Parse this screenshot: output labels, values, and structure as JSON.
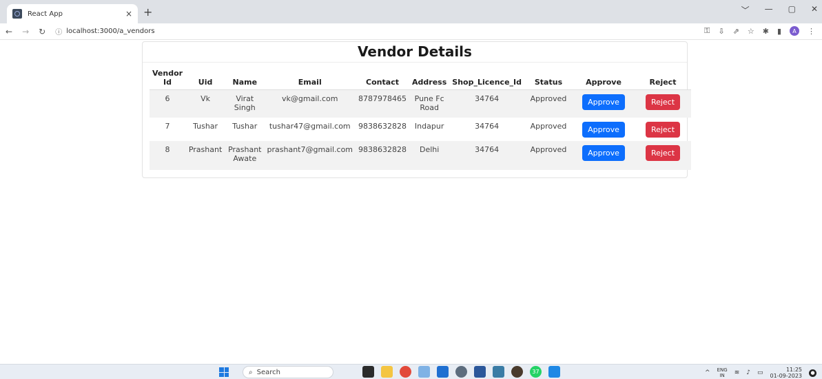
{
  "browser": {
    "tab_title": "React App",
    "tab_close": "×",
    "new_tab": "+",
    "url": "localhost:3000/a_vendors",
    "window_controls": [
      "﹀",
      "—",
      "▢",
      "✕"
    ],
    "avatar_letter": "A"
  },
  "page": {
    "title": "Vendor Details"
  },
  "table": {
    "headers": [
      "Vendor\nId",
      "Uid",
      "Name",
      "Email",
      "Contact",
      "Address",
      "Shop_Licence_Id",
      "Status",
      "Approve",
      "Reject"
    ],
    "rows": [
      {
        "vendor_id": "6",
        "uid": "Vk",
        "name": "Virat Singh",
        "email": "vk@gmail.com",
        "contact": "8787978465",
        "address": "Pune Fc Road",
        "shop_licence_id": "34764",
        "status": "Approved",
        "approve_label": "Approve",
        "reject_label": "Reject"
      },
      {
        "vendor_id": "7",
        "uid": "Tushar",
        "name": "Tushar",
        "email": "tushar47@gmail.com",
        "contact": "9838632828",
        "address": "Indapur",
        "shop_licence_id": "34764",
        "status": "Approved",
        "approve_label": "Approve",
        "reject_label": "Reject"
      },
      {
        "vendor_id": "8",
        "uid": "Prashant",
        "name": "Prashant Awate",
        "email": "prashant7@gmail.com",
        "contact": "9838632828",
        "address": "Delhi",
        "shop_licence_id": "34764",
        "status": "Approved",
        "approve_label": "Approve",
        "reject_label": "Reject"
      }
    ]
  },
  "taskbar": {
    "search_placeholder": "Search",
    "lang_line1": "ENG",
    "lang_line2": "IN",
    "time": "11:25",
    "date": "01-09-2023",
    "badge_count": "37"
  },
  "colors": {
    "approve": "#0d6efd",
    "reject": "#dc3545"
  }
}
